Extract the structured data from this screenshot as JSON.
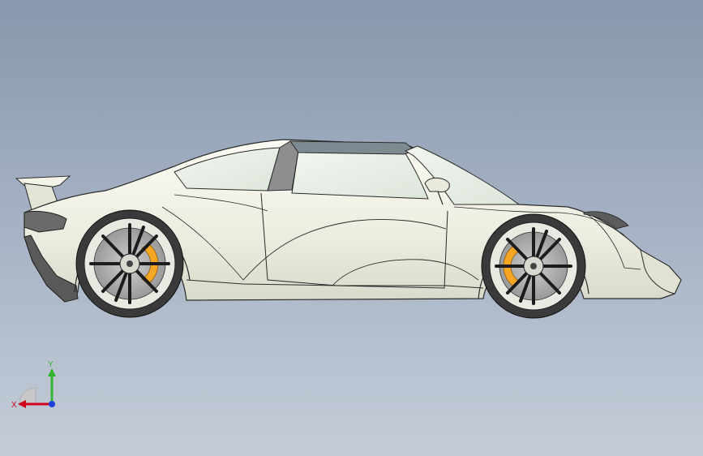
{
  "viewport": {
    "background_top": "#8897ad",
    "background_bottom": "#c4ccd8"
  },
  "model": {
    "body_color": "#f4f4ea",
    "glass_color": "#e9efe6",
    "caliper_color": "#f5a623",
    "tire_color": "#3a3a3a",
    "outline_color": "#2a2a2a"
  },
  "triad": {
    "x_label": "X",
    "y_label": "Y",
    "x_color": "#d0021b",
    "y_color": "#2fb52f",
    "z_color": "#1f3fd6"
  }
}
